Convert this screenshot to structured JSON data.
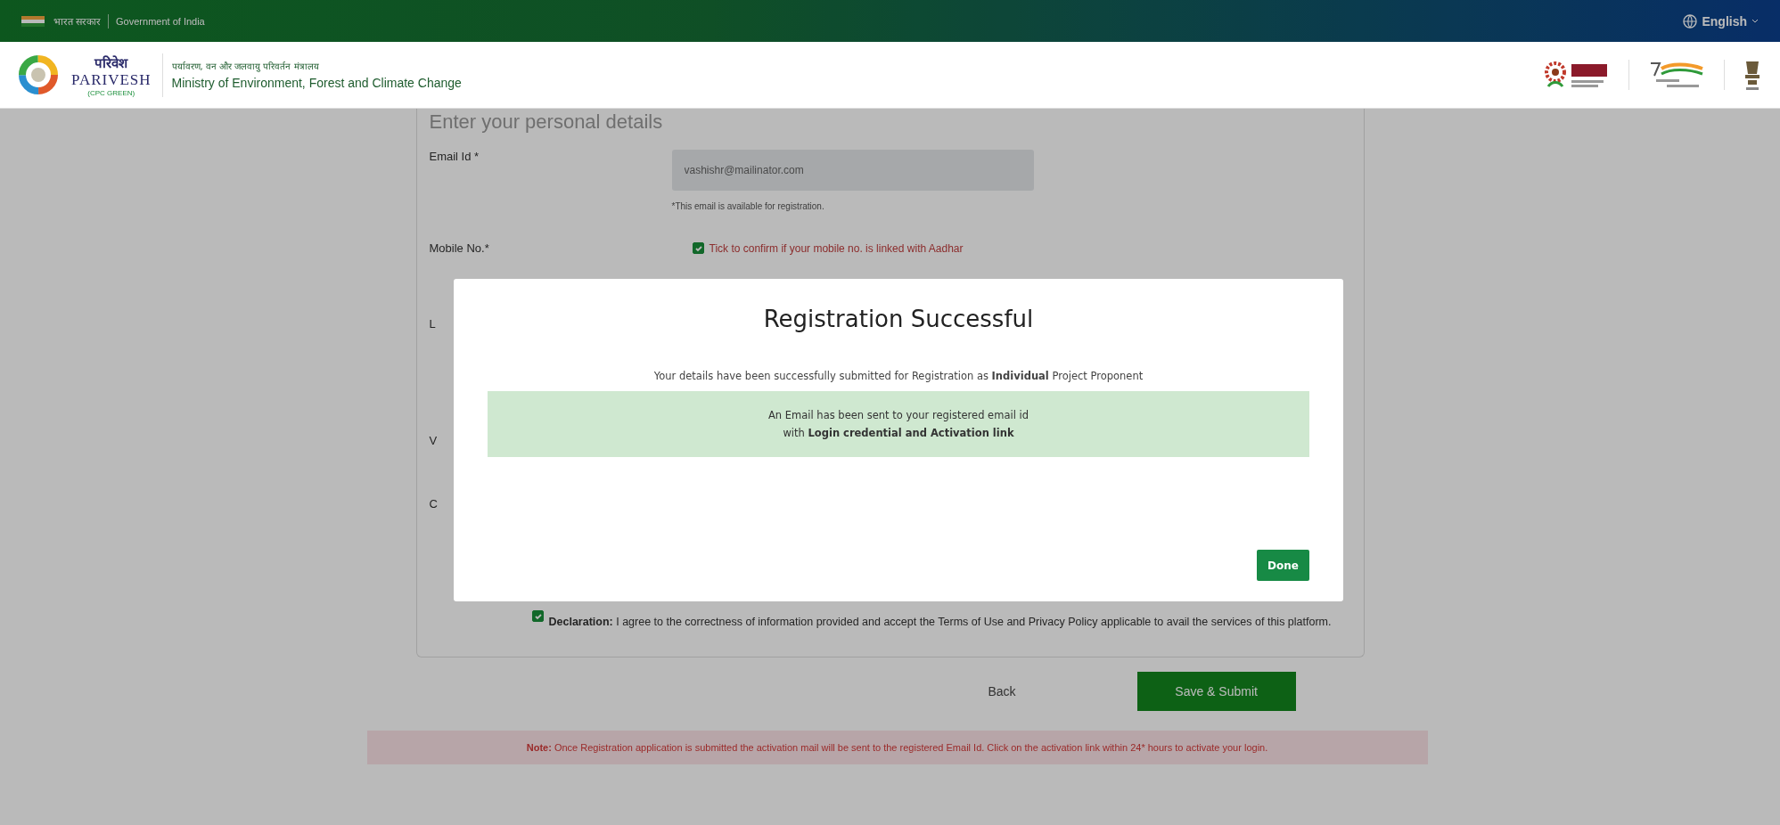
{
  "top_bar": {
    "hindi_label": "भारत सरकार",
    "label": "Government of India",
    "language": "English"
  },
  "header": {
    "logo_hindi": "परिवेश",
    "logo_name": "PARIVESH",
    "logo_tag": "(CPC GREEN)",
    "ministry_hindi": "पर्यावरण, वन और जलवायु परिवर्तन मंत्रालय",
    "ministry": "Ministry of Environment, Forest and Climate Change"
  },
  "form": {
    "title": "Enter your personal details",
    "email": {
      "label": "Email Id *",
      "value": "vashishr@mailinator.com",
      "help": "*This email is available for registration."
    },
    "mobile": {
      "label": "Mobile No.*",
      "confirm": {
        "label": "Tick to confirm if your mobile no. is linked with Aadhar",
        "checked": true
      }
    },
    "hidden_labels": [
      "L",
      "V",
      "C"
    ],
    "declaration": {
      "text": "**Declaration:** I agree to the correctness of information provided and accept the Terms of Use and Privacy Policy applicable to avail the services of this platform.",
      "checked": true
    },
    "buttons": {
      "back": "Back",
      "submit": "Save & Submit"
    },
    "note": "**Note:** Once Registration application is submitted the activation mail will be sent to the registered Email Id. Click on the activation link within 24* hours to activate your login."
  },
  "modal": {
    "title": "Registration Successful",
    "message": "Your details have been successfully submitted for Registration as **Individual** Project Proponent",
    "notice_lines": [
      "An Email has been sent to your registered email id",
      "with **Login credential and Activation link**"
    ],
    "button": "Done"
  }
}
